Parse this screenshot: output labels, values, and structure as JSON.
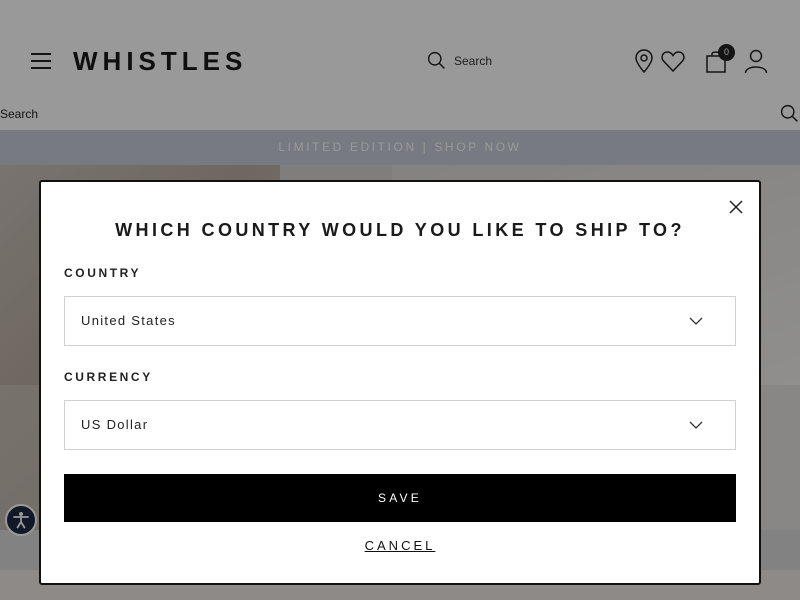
{
  "header": {
    "logo": "WHISTLES",
    "search_label": "Search",
    "bag_count": "0"
  },
  "search_bar": {
    "label": "Search"
  },
  "promo": {
    "text": "LIMITED EDITION | SHOP NOW"
  },
  "icons": {
    "menu": "hamburger-menu-icon",
    "search": "search-icon",
    "location": "map-pin-icon",
    "wishlist": "heart-icon",
    "bag": "shopping-bag-icon",
    "account": "user-icon",
    "close": "close-icon",
    "dropdown": "chevron-down-icon",
    "accessibility": "accessibility-icon"
  },
  "colors": {
    "promo_bar": "#c7ccd6",
    "save_button": "#000000",
    "accessibility_button": "#1d2a44"
  },
  "modal": {
    "title": "WHICH COUNTRY WOULD YOU LIKE TO SHIP TO?",
    "country_label": "COUNTRY",
    "country_value": "United States",
    "currency_label": "CURRENCY",
    "currency_value": "US Dollar",
    "save_label": "SAVE",
    "cancel_label": "CANCEL"
  }
}
